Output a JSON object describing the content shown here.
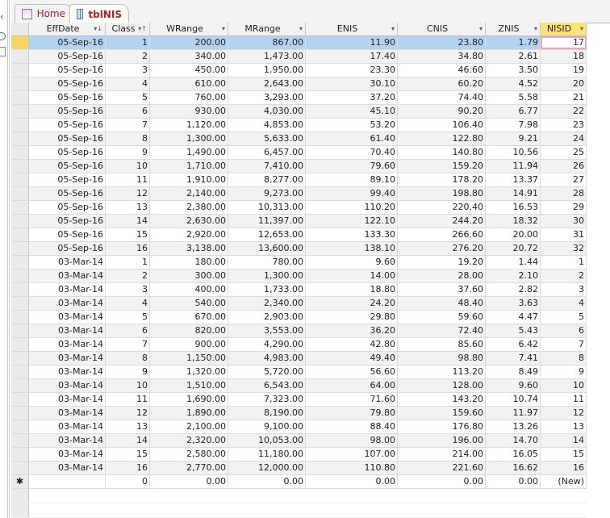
{
  "tabs": [
    {
      "label": "Home",
      "icon": "form-icon"
    },
    {
      "label": "tblNIS",
      "icon": "table-icon"
    }
  ],
  "columns": [
    {
      "label": "EffDate",
      "arrow": "▾↓"
    },
    {
      "label": "Class",
      "arrow": "▾↑"
    },
    {
      "label": "WRange",
      "arrow": "▾"
    },
    {
      "label": "MRange",
      "arrow": "▾"
    },
    {
      "label": "ENIS",
      "arrow": "▾"
    },
    {
      "label": "CNIS",
      "arrow": "▾"
    },
    {
      "label": "ZNIS",
      "arrow": "▾"
    },
    {
      "label": "NISID",
      "arrow": "▾"
    }
  ],
  "rows": [
    [
      "05-Sep-16",
      "1",
      "200.00",
      "867.00",
      "11.90",
      "23.80",
      "1.79",
      "17"
    ],
    [
      "05-Sep-16",
      "2",
      "340.00",
      "1,473.00",
      "17.40",
      "34.80",
      "2.61",
      "18"
    ],
    [
      "05-Sep-16",
      "3",
      "450.00",
      "1,950.00",
      "23.30",
      "46.60",
      "3.50",
      "19"
    ],
    [
      "05-Sep-16",
      "4",
      "610.00",
      "2,643.00",
      "30.10",
      "60.20",
      "4.52",
      "20"
    ],
    [
      "05-Sep-16",
      "5",
      "760.00",
      "3,293.00",
      "37.20",
      "74.40",
      "5.58",
      "21"
    ],
    [
      "05-Sep-16",
      "6",
      "930.00",
      "4,030.00",
      "45.10",
      "90.20",
      "6.77",
      "22"
    ],
    [
      "05-Sep-16",
      "7",
      "1,120.00",
      "4,853.00",
      "53.20",
      "106.40",
      "7.98",
      "23"
    ],
    [
      "05-Sep-16",
      "8",
      "1,300.00",
      "5,633.00",
      "61.40",
      "122.80",
      "9.21",
      "24"
    ],
    [
      "05-Sep-16",
      "9",
      "1,490.00",
      "6,457.00",
      "70.40",
      "140.80",
      "10.56",
      "25"
    ],
    [
      "05-Sep-16",
      "10",
      "1,710.00",
      "7,410.00",
      "79.60",
      "159.20",
      "11.94",
      "26"
    ],
    [
      "05-Sep-16",
      "11",
      "1,910.00",
      "8,277.00",
      "89.10",
      "178.20",
      "13.37",
      "27"
    ],
    [
      "05-Sep-16",
      "12",
      "2,140.00",
      "9,273.00",
      "99.40",
      "198.80",
      "14.91",
      "28"
    ],
    [
      "05-Sep-16",
      "13",
      "2,380.00",
      "10,313.00",
      "110.20",
      "220.40",
      "16.53",
      "29"
    ],
    [
      "05-Sep-16",
      "14",
      "2,630.00",
      "11,397.00",
      "122.10",
      "244.20",
      "18.32",
      "30"
    ],
    [
      "05-Sep-16",
      "15",
      "2,920.00",
      "12,653.00",
      "133.30",
      "266.60",
      "20.00",
      "31"
    ],
    [
      "05-Sep-16",
      "16",
      "3,138.00",
      "13,600.00",
      "138.10",
      "276.20",
      "20.72",
      "32"
    ],
    [
      "03-Mar-14",
      "1",
      "180.00",
      "780.00",
      "9.60",
      "19.20",
      "1.44",
      "1"
    ],
    [
      "03-Mar-14",
      "2",
      "300.00",
      "1,300.00",
      "14.00",
      "28.00",
      "2.10",
      "2"
    ],
    [
      "03-Mar-14",
      "3",
      "400.00",
      "1,733.00",
      "18.80",
      "37.60",
      "2.82",
      "3"
    ],
    [
      "03-Mar-14",
      "4",
      "540.00",
      "2,340.00",
      "24.20",
      "48.40",
      "3.63",
      "4"
    ],
    [
      "03-Mar-14",
      "5",
      "670.00",
      "2,903.00",
      "29.80",
      "59.60",
      "4.47",
      "5"
    ],
    [
      "03-Mar-14",
      "6",
      "820.00",
      "3,553.00",
      "36.20",
      "72.40",
      "5.43",
      "6"
    ],
    [
      "03-Mar-14",
      "7",
      "900.00",
      "4,290.00",
      "42.80",
      "85.60",
      "6.42",
      "7"
    ],
    [
      "03-Mar-14",
      "8",
      "1,150.00",
      "4,983.00",
      "49.40",
      "98.80",
      "7.41",
      "8"
    ],
    [
      "03-Mar-14",
      "9",
      "1,320.00",
      "5,720.00",
      "56.60",
      "113.20",
      "8.49",
      "9"
    ],
    [
      "03-Mar-14",
      "10",
      "1,510.00",
      "6,543.00",
      "64.00",
      "128.00",
      "9.60",
      "10"
    ],
    [
      "03-Mar-14",
      "11",
      "1,690.00",
      "7,323.00",
      "71.60",
      "143.20",
      "10.74",
      "11"
    ],
    [
      "03-Mar-14",
      "12",
      "1,890.00",
      "8,190.00",
      "79.80",
      "159.60",
      "11.97",
      "12"
    ],
    [
      "03-Mar-14",
      "13",
      "2,100.00",
      "9,100.00",
      "88.40",
      "176.80",
      "13.26",
      "13"
    ],
    [
      "03-Mar-14",
      "14",
      "2,320.00",
      "10,053.00",
      "98.00",
      "196.00",
      "14.70",
      "14"
    ],
    [
      "03-Mar-14",
      "15",
      "2,580.00",
      "11,180.00",
      "107.00",
      "214.00",
      "16.05",
      "15"
    ],
    [
      "03-Mar-14",
      "16",
      "2,770.00",
      "12,000.00",
      "110.80",
      "221.60",
      "16.62",
      "16"
    ]
  ],
  "new_row": {
    "marker": "✱",
    "values": [
      "",
      "0",
      "0.00",
      "0.00",
      "0.00",
      "0.00",
      "0.00",
      "(New)"
    ]
  }
}
